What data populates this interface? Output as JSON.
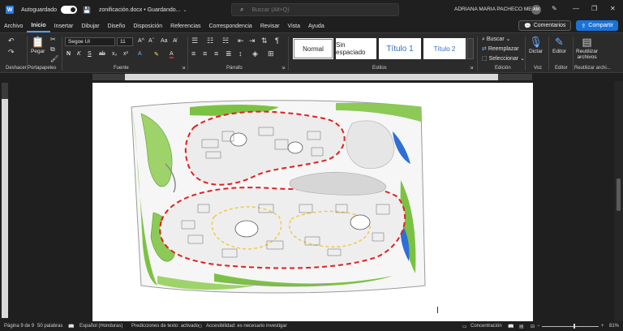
{
  "titlebar": {
    "app_icon": "word-logo",
    "app_icon_letter": "W",
    "autosave_label": "Autoguardado",
    "doc_title": "zonificación.docx • Guardando...",
    "search_placeholder": "Buscar (Alt+Q)",
    "user_name": "ADRIANA MARIA PACHECO MEJIA",
    "avatar_initials": "AM"
  },
  "menu": {
    "tabs": [
      "Archivo",
      "Inicio",
      "Insertar",
      "Dibujar",
      "Diseño",
      "Disposición",
      "Referencias",
      "Correspondencia",
      "Revisar",
      "Vista",
      "Ayuda"
    ],
    "active_tab": "Inicio",
    "comments_label": "Comentarios",
    "share_label": "Compartir"
  },
  "ribbon": {
    "undo_label": "Deshacer",
    "clipboard": {
      "paste_label": "Pegar",
      "group_label": "Portapapeles"
    },
    "font": {
      "name": "Segoe UI",
      "size": "11",
      "group_label": "Fuente",
      "bold": "N",
      "italic": "K",
      "underline": "S"
    },
    "paragraph": {
      "group_label": "Párrafo"
    },
    "styles": {
      "items": [
        "Normal",
        "Sin espaciado",
        "Título 1",
        "Título 2"
      ],
      "group_label": "Estilos"
    },
    "editing": {
      "find_label": "Buscar",
      "replace_label": "Reemplazar",
      "select_label": "Seleccionar",
      "group_label": "Edición"
    },
    "voice": {
      "dictate_label": "Dictar",
      "group_label": "Voz"
    },
    "editor": {
      "editor_label": "Editor",
      "group_label": "Editor"
    },
    "reuse": {
      "label_line1": "Reutilizar",
      "label_line2": "archivos",
      "group_label": "Reutilizar archi..."
    }
  },
  "statusbar": {
    "page": "Página 9 de 9",
    "words": "50 palabras",
    "language": "Español (Honduras)",
    "predictions": "Predicciones de texto: activado",
    "accessibility": "Accesibilidad: es necesario investigar",
    "focus_label": "Concentración",
    "zoom": "81%"
  },
  "colors": {
    "accent": "#1a73d6",
    "plan_green": "#7cc242",
    "plan_red_dash": "#e02020",
    "plan_yellow_dash": "#f2c94c",
    "plan_blue": "#2d6fd6"
  }
}
